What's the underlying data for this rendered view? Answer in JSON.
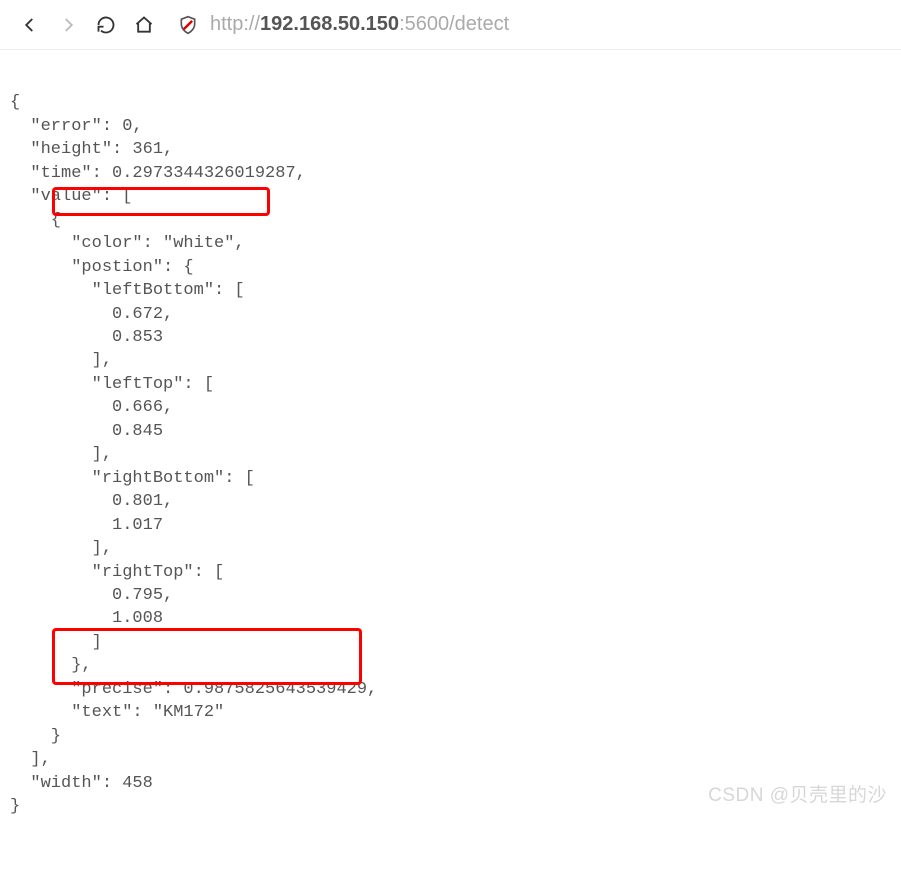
{
  "toolbar": {
    "url_proto": "http://",
    "url_host": "192.168.50.150",
    "url_port": ":5600",
    "url_path": "/detect"
  },
  "json": {
    "line01": "{",
    "line02": "  ″error″: 0,",
    "line03": "  ″height″: 361,",
    "line04": "  ″time″: 0.2973344326019287,",
    "line05": "  ″value″: [",
    "line06": "    {",
    "line07": "      ″color″: ″white″,",
    "line08": "      ″postion″: {",
    "line09": "        ″leftBottom″: [",
    "line10": "          0.672,",
    "line11": "          0.853",
    "line12": "        ],",
    "line13": "        ″leftTop″: [",
    "line14": "          0.666,",
    "line15": "          0.845",
    "line16": "        ],",
    "line17": "        ″rightBottom″: [",
    "line18": "          0.801,",
    "line19": "          1.017",
    "line20": "        ],",
    "line21": "        ″rightTop″: [",
    "line22": "          0.795,",
    "line23": "          1.008",
    "line24": "        ]",
    "line25": "      },",
    "line26": "      ″precise″: 0.9875825643539429,",
    "line27": "      ″text″: ″KM172″",
    "line28": "    }",
    "line29": "  ],",
    "line30": "  ″width″: 458",
    "line31": "}"
  },
  "watermark": "CSDN @贝壳里的沙"
}
